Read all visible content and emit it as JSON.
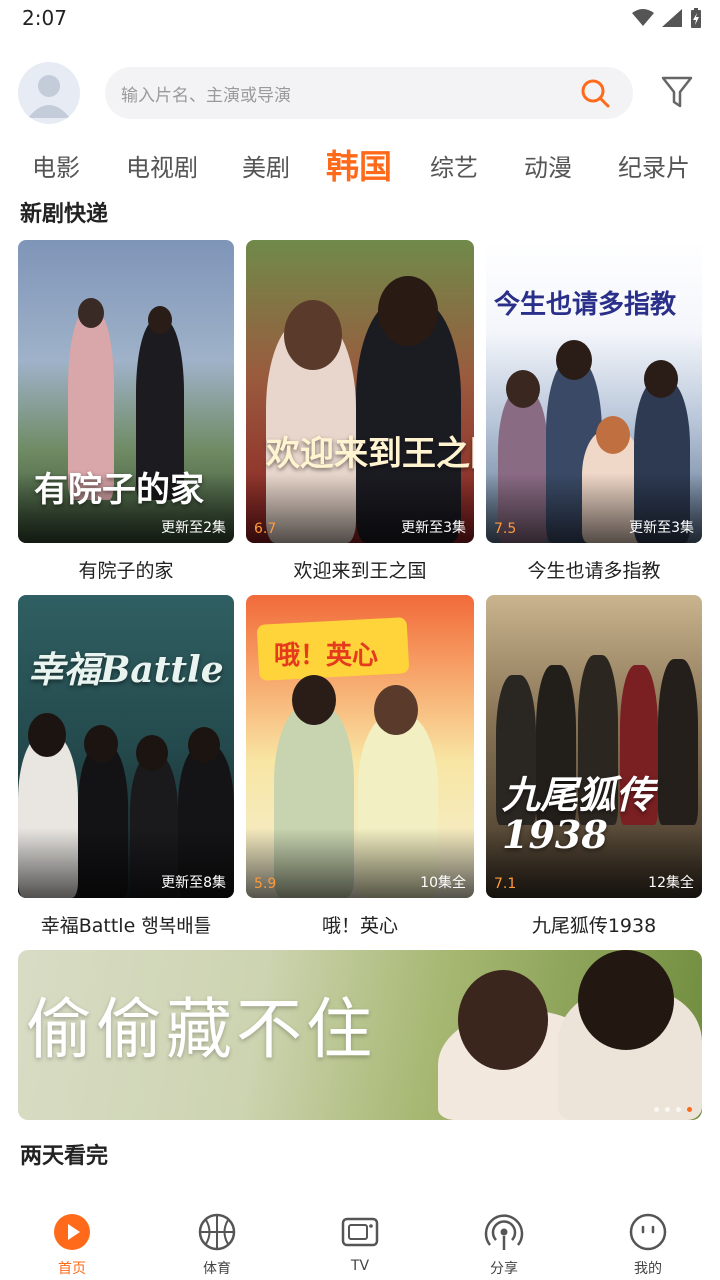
{
  "status": {
    "time": "2:07"
  },
  "search": {
    "placeholder": "输入片名、主演或导演"
  },
  "tabs": [
    {
      "label": "电影"
    },
    {
      "label": "电视剧"
    },
    {
      "label": "美剧"
    },
    {
      "label": "韩国"
    },
    {
      "label": "综艺"
    },
    {
      "label": "动漫"
    },
    {
      "label": "纪录片"
    }
  ],
  "active_tab": "韩国",
  "sections": {
    "new_dramas": "新剧快递",
    "binge": "两天看完"
  },
  "cards": [
    {
      "label": "有院子的家",
      "poster_text": "有院子的家",
      "rating": "",
      "episodes": "更新至2集"
    },
    {
      "label": "欢迎来到王之国",
      "poster_text": "欢迎来到王之国",
      "rating": "6.7",
      "episodes": "更新至3集"
    },
    {
      "label": "今生也请多指教",
      "poster_text": "今生也请多指教",
      "rating": "7.5",
      "episodes": "更新至3集"
    },
    {
      "label": "幸福Battle 행복배틀",
      "poster_text": "幸福Battle",
      "rating": "",
      "episodes": "更新至8集"
    },
    {
      "label": "哦！英心",
      "poster_text": "哦！英心",
      "rating": "5.9",
      "episodes": "10集全"
    },
    {
      "label": "九尾狐传1938",
      "poster_text": "九尾狐传1938",
      "rating": "7.1",
      "episodes": "12集全"
    }
  ],
  "banner": {
    "title": "偷偷藏不住"
  },
  "bottom_nav": [
    {
      "label": "首页",
      "icon": "play-circle-icon"
    },
    {
      "label": "体育",
      "icon": "basketball-icon"
    },
    {
      "label": "TV",
      "icon": "tv-icon"
    },
    {
      "label": "分享",
      "icon": "broadcast-icon"
    },
    {
      "label": "我的",
      "icon": "smiley-face-icon"
    }
  ],
  "colors": {
    "accent": "#ff6a1a",
    "rating": "#ff9a3a"
  }
}
